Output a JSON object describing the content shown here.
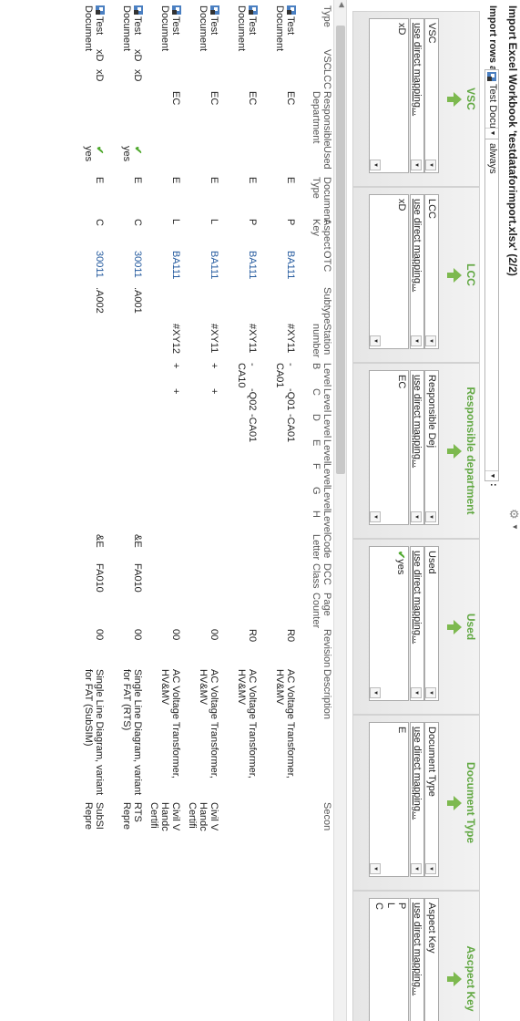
{
  "window": {
    "title": "Import Excel Workbook 'testdataforimport.xlsx' (2/2)",
    "gear_icon": "gear-icon"
  },
  "import_as": {
    "label": "Import rows as",
    "doc_type_value": "Test Docu",
    "condition_value": "always",
    "colon": ":"
  },
  "mapping": [
    {
      "header": "VSC",
      "column": "VSC",
      "mode": "use direct mapping...",
      "example_src": "xD",
      "example_dst": "xD"
    },
    {
      "header": "LCC",
      "column": "LCC",
      "mode": "use direct mapping...",
      "example_src": "xD",
      "example_dst": "xD"
    },
    {
      "header": "Responsible department",
      "column": "Responsible Dej",
      "mode": "use direct mapping...",
      "example_src": "EC",
      "example_dst": "EC"
    },
    {
      "header": "Used",
      "column": "Used",
      "mode": "use direct mapping...",
      "example_src": "y",
      "example_dst": "yes"
    },
    {
      "header": "Document Type",
      "column": "Document Type",
      "mode": "use direct mapping...",
      "example_src": "E",
      "example_dst": "E"
    },
    {
      "header": "Ascpect Key",
      "column": "Aspect Key",
      "mode": "use direct mapping...",
      "example_src": "P",
      "example_dst": "P",
      "extra": [
        {
          "src": "L",
          "dst": "L"
        },
        {
          "src": "C",
          "dst": "C"
        }
      ]
    }
  ],
  "table": {
    "columns": [
      "Type",
      "VSC",
      "LCC",
      "Responsible Department",
      "Used",
      "Document Type",
      "Aspect Key",
      "OTC",
      "Subtype",
      "Station number",
      "Level B",
      "Level C",
      "Level D",
      "Level E",
      "Level F",
      "Level G",
      "Level H",
      "Code Letter",
      "DCC Class",
      "Page Counter",
      "Revision",
      "Description",
      "Secon"
    ],
    "rows": [
      {
        "type": "Test Document",
        "vsc": "",
        "lcc": "",
        "dept": "EC",
        "used": "",
        "doctype": "E",
        "aspect": "P",
        "otc": "BA111",
        "subtype": "",
        "station": "#XY11",
        "levelB": "-CA01",
        "levelC": "-Q01",
        "levelD": "-CA01",
        "code": "",
        "dcc": "",
        "page": "",
        "rev": "R0",
        "desc": "AC Voltage Transformer, HV&MV",
        "second": ""
      },
      {
        "type": "Test Document",
        "vsc": "",
        "lcc": "",
        "dept": "EC",
        "used": "",
        "doctype": "E",
        "aspect": "P",
        "otc": "BA111",
        "subtype": "",
        "station": "#XY11",
        "levelB": "-CA10",
        "levelC": "-Q02",
        "levelD": "-CA01",
        "code": "",
        "dcc": "",
        "page": "",
        "rev": "R0",
        "desc": "AC Voltage Transformer, HV&MV",
        "second": ""
      },
      {
        "type": "Test Document",
        "vsc": "",
        "lcc": "",
        "dept": "EC",
        "used": "",
        "doctype": "E",
        "aspect": "L",
        "otc": "BA111",
        "subtype": "",
        "station": "#XY11",
        "levelB": "+",
        "levelC": "+",
        "levelD": "",
        "code": "",
        "dcc": "",
        "page": "",
        "rev": "00",
        "desc": "AC Voltage Transformer, HV&MV",
        "second": "Civil V Handc Certifi"
      },
      {
        "type": "Test Document",
        "vsc": "",
        "lcc": "",
        "dept": "EC",
        "used": "",
        "doctype": "E",
        "aspect": "L",
        "otc": "BA111",
        "subtype": "",
        "station": "#XY12",
        "levelB": "+",
        "levelC": "+",
        "levelD": "",
        "code": "",
        "dcc": "",
        "page": "",
        "rev": "00",
        "desc": "AC Voltage Transformer, HV&MV",
        "second": "Civil V Handc Certifi"
      },
      {
        "type": "Test Document",
        "vsc": "xD",
        "lcc": "xD",
        "dept": "",
        "used": "yes",
        "doctype": "E",
        "aspect": "C",
        "otc": "30011",
        "subtype": ".A001",
        "station": "",
        "levelB": "",
        "levelC": "",
        "levelD": "",
        "code": "&E",
        "dcc": "FA010",
        "page": "",
        "rev": "00",
        "desc": "Single Line Diagram, variant for FAT (RTS)",
        "second": "RTS Repre"
      },
      {
        "type": "Test Document",
        "vsc": "xD",
        "lcc": "xD",
        "dept": "",
        "used": "yes",
        "doctype": "E",
        "aspect": "C",
        "otc": "30011",
        "subtype": ".A002",
        "station": "",
        "levelB": "",
        "levelC": "",
        "levelD": "",
        "code": "&E",
        "dcc": "FA010",
        "page": "",
        "rev": "00",
        "desc": "Single Line Diagram, variant for FAT (SubSIM)",
        "second": "SubSI Repre"
      }
    ]
  }
}
